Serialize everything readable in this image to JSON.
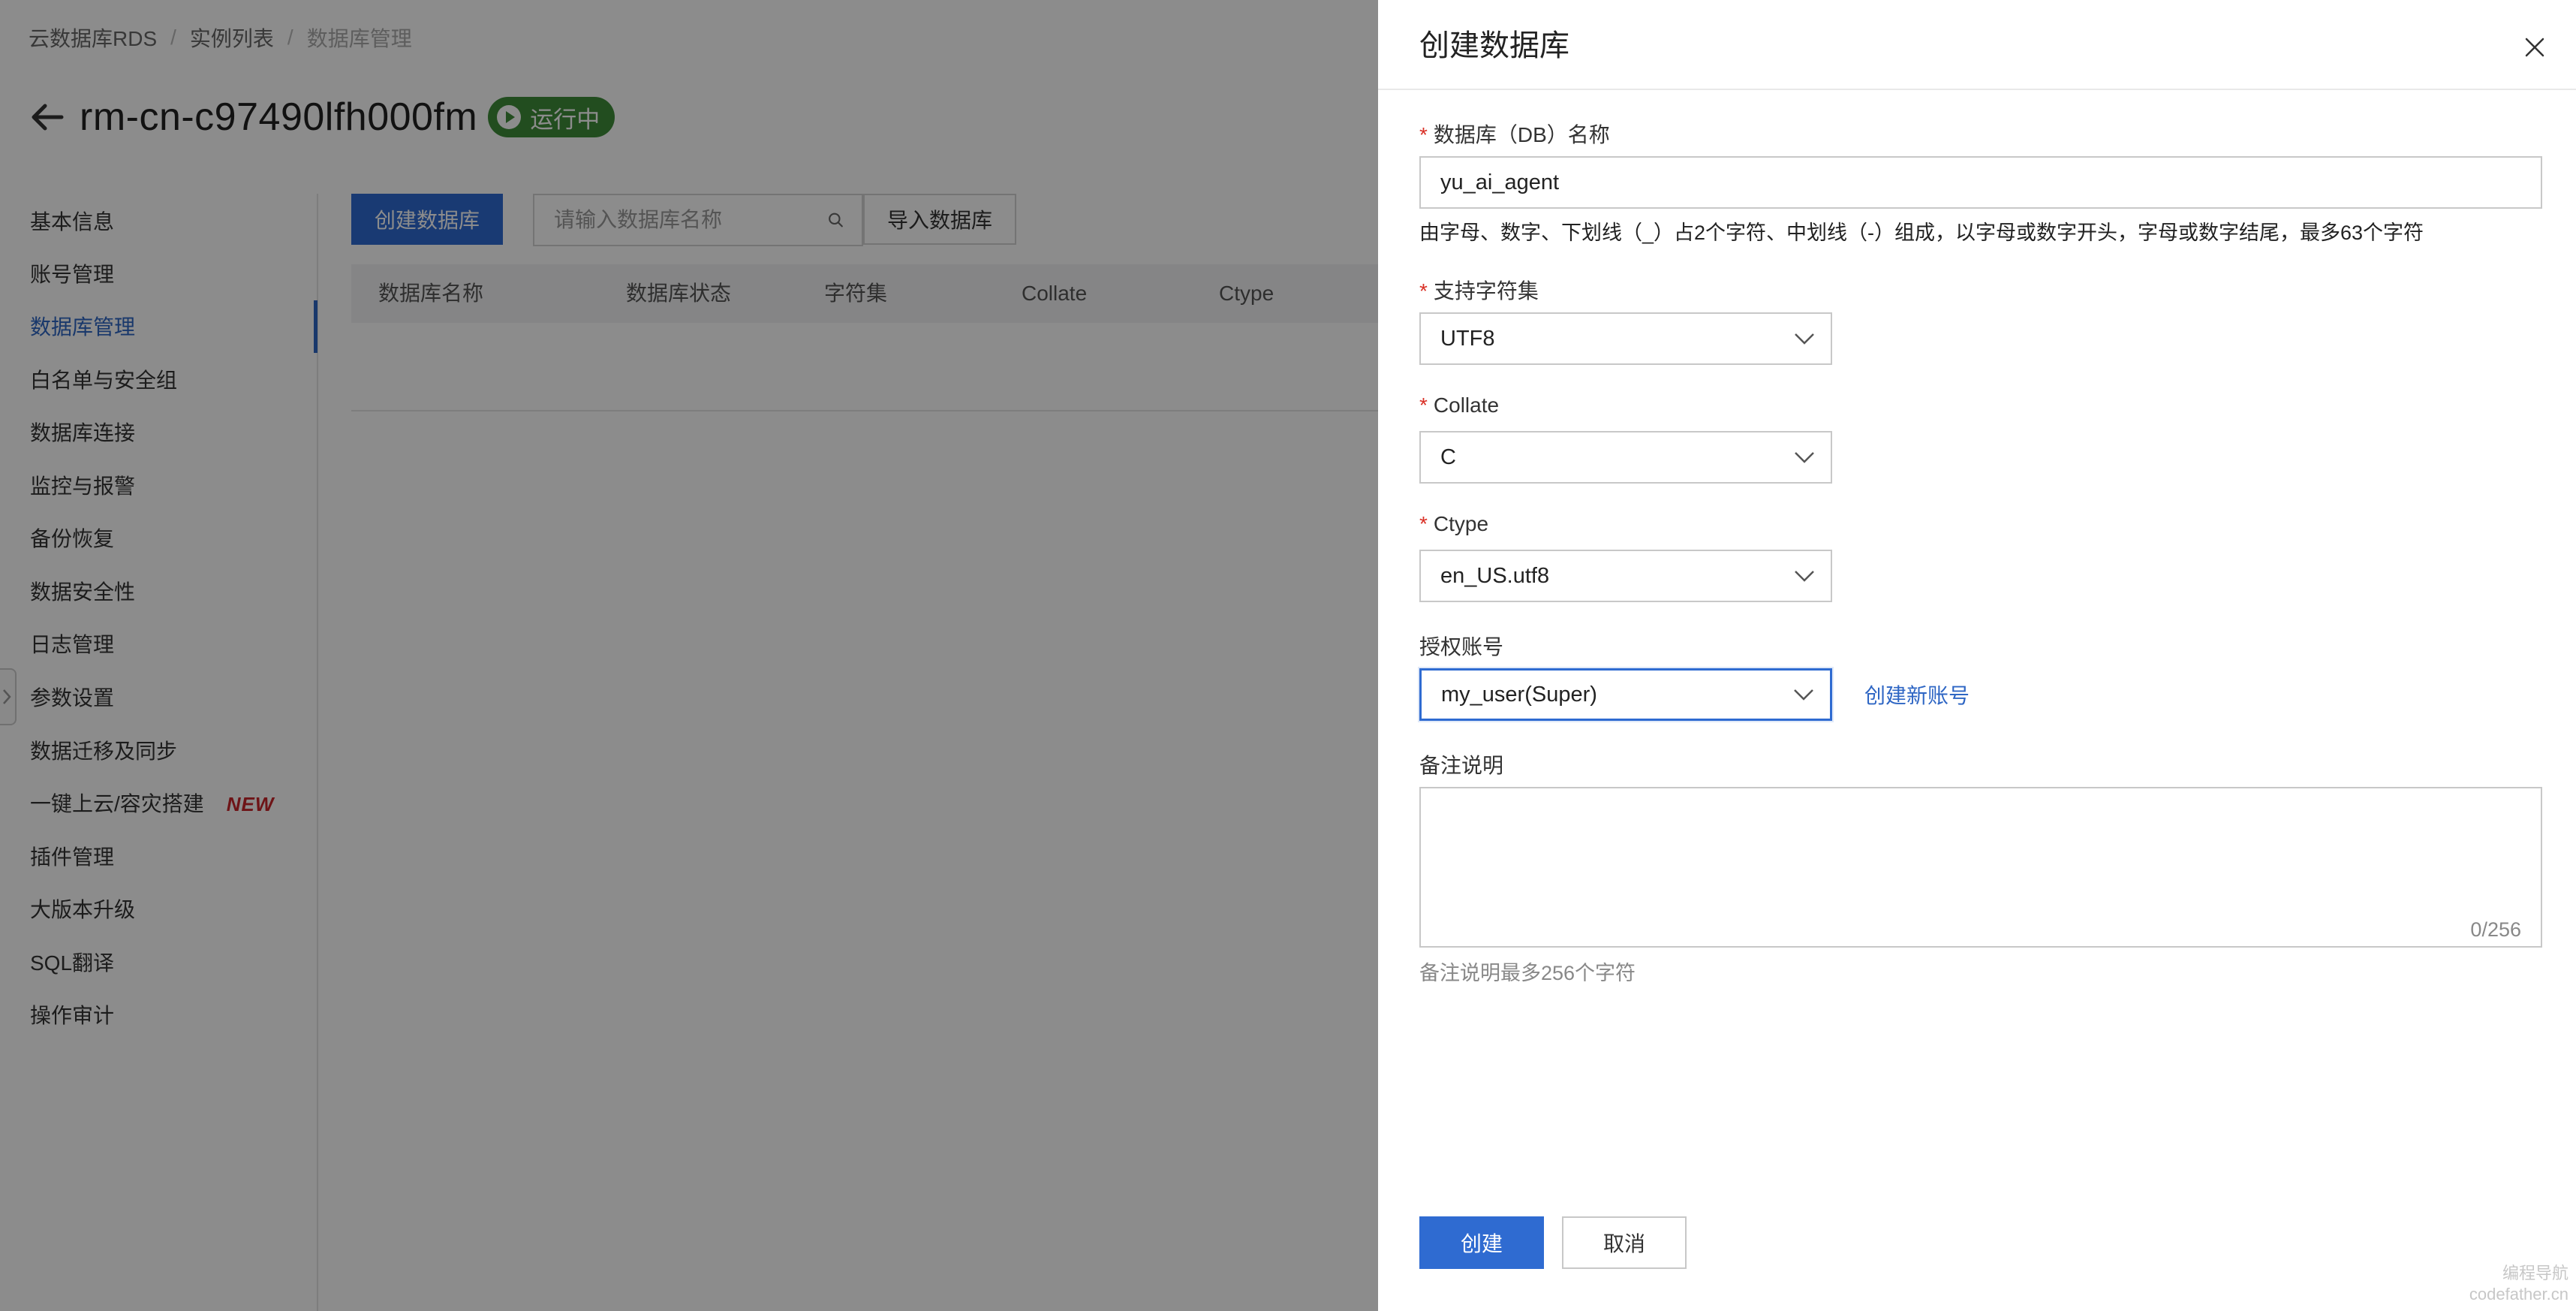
{
  "breadcrumb": {
    "items": [
      "云数据库RDS",
      "实例列表",
      "数据库管理"
    ],
    "separator": "/"
  },
  "instance": {
    "title": "rm-cn-c97490lfh000fm",
    "status": "运行中",
    "status_color": "#3f8c3a"
  },
  "sidebar": {
    "items": [
      {
        "label": "基本信息"
      },
      {
        "label": "账号管理"
      },
      {
        "label": "数据库管理",
        "active": true
      },
      {
        "label": "白名单与安全组"
      },
      {
        "label": "数据库连接"
      },
      {
        "label": "监控与报警"
      },
      {
        "label": "备份恢复"
      },
      {
        "label": "数据安全性"
      },
      {
        "label": "日志管理"
      },
      {
        "label": "参数设置"
      },
      {
        "label": "数据迁移及同步"
      },
      {
        "label": "一键上云/容灾搭建",
        "badge": "NEW"
      },
      {
        "label": "插件管理"
      },
      {
        "label": "大版本升级"
      },
      {
        "label": "SQL翻译"
      },
      {
        "label": "操作审计"
      }
    ]
  },
  "toolbar": {
    "create_label": "创建数据库",
    "search_placeholder": "请输入数据库名称",
    "import_label": "导入数据库"
  },
  "table": {
    "columns": [
      "数据库名称",
      "数据库状态",
      "字符集",
      "Collate",
      "Ctype"
    ]
  },
  "drawer": {
    "title": "创建数据库",
    "db_name": {
      "label": "数据库（DB）名称",
      "value": "yu_ai_agent",
      "hint": "由字母、数字、下划线（_）占2个字符、中划线（-）组成，以字母或数字开头，字母或数字结尾，最多63个字符"
    },
    "charset": {
      "label": "支持字符集",
      "value": "UTF8"
    },
    "collate": {
      "label": "Collate",
      "value": "C"
    },
    "ctype": {
      "label": "Ctype",
      "value": "en_US.utf8"
    },
    "account": {
      "label": "授权账号",
      "value": "my_user(Super)",
      "link": "创建新账号"
    },
    "remark": {
      "label": "备注说明",
      "counter": "0/256",
      "hint": "备注说明最多256个字符"
    },
    "create_label": "创建",
    "cancel_label": "取消"
  },
  "watermark": {
    "line1": "编程导航",
    "line2": "codefather.cn"
  },
  "colors": {
    "primary": "#2f6bd1",
    "link": "#2e66c4",
    "required": "#d93026",
    "new_badge": "#c8262b"
  }
}
